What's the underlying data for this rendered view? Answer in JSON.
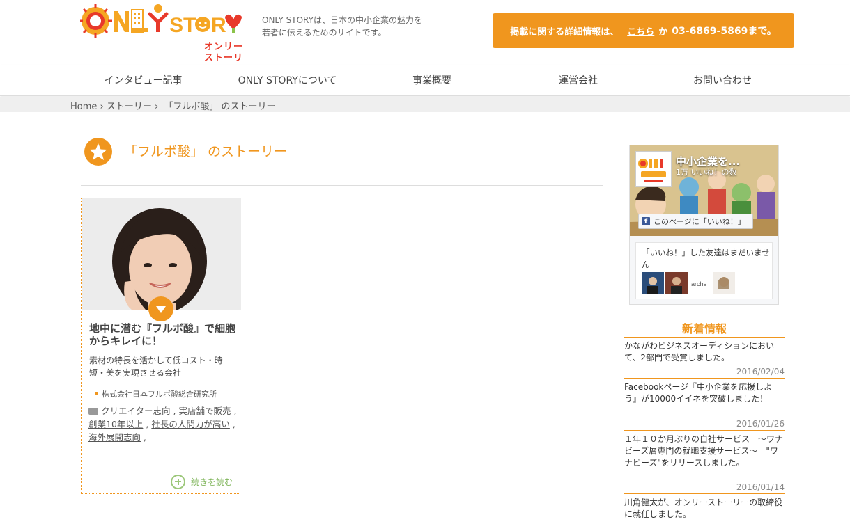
{
  "header": {
    "logo": {
      "main": "ONLY STORY",
      "sub": "オンリーストーリー"
    },
    "tagline_line1": "ONLY STORYは、日本の中小企業の魅力を",
    "tagline_line2": "若者に伝えるためのサイトです。",
    "cta": {
      "prefix": "掲載に関する詳細情報は、",
      "link": "こちら",
      "middle": "か",
      "phone": "03-6869-5869まで。"
    }
  },
  "nav": {
    "items": [
      {
        "label": "インタビュー記事"
      },
      {
        "label": "ONLY STORYについて"
      },
      {
        "label": "事業概要"
      },
      {
        "label": "運営会社"
      },
      {
        "label": "お問い合わせ"
      }
    ]
  },
  "breadcrumb": {
    "home": "Home",
    "sep": "›",
    "stories": "ストーリー",
    "current": "「フルボ酸」 のストーリー"
  },
  "page": {
    "title": "「フルボ酸」 のストーリー"
  },
  "card": {
    "heading": "地中に潜む『フルボ酸』で細胞からキレイに！",
    "desc": "素材の特長を活かして低コスト・時短・美を実現させる会社",
    "company": "株式会社日本フルボ酸総合研究所",
    "tags": [
      "クリエイター志向",
      "実店舗で販売",
      "創業10年以上",
      "社長の人間力が高い",
      "海外展開志向"
    ],
    "tag_sep": ",",
    "more": "続きを読む"
  },
  "facebook": {
    "page_name": "中小企業を...",
    "likes": "1万 いいね！の数",
    "like_button": "このページに「いいね！」",
    "f": "f",
    "friends_text": "「いいね！」した友達はまだいません",
    "avatar_archs": "archs"
  },
  "news": {
    "title": "新着情報",
    "items": [
      {
        "text": "かながわビジネスオーディションにおいて、2部門で受賞しました。",
        "date": "2016/02/04"
      },
      {
        "text": "Facebookページ『中小企業を応援しよう』が10000イイネを突破しました！",
        "date": "2016/01/26"
      },
      {
        "text": "１年１０か月ぶりの自社サービス　〜ワナビーズ層専門の就職支援サービス〜　\"ワナビーズ\"をリリースしました。",
        "date": "2016/01/14"
      },
      {
        "text": "川角健太が、オンリーストーリーの取締役に就任しました。",
        "date": ""
      }
    ]
  },
  "colors": {
    "accent": "#f0961e",
    "logo_red": "#e8392a",
    "green": "#7fb55a",
    "fb_blue": "#3b5998"
  }
}
